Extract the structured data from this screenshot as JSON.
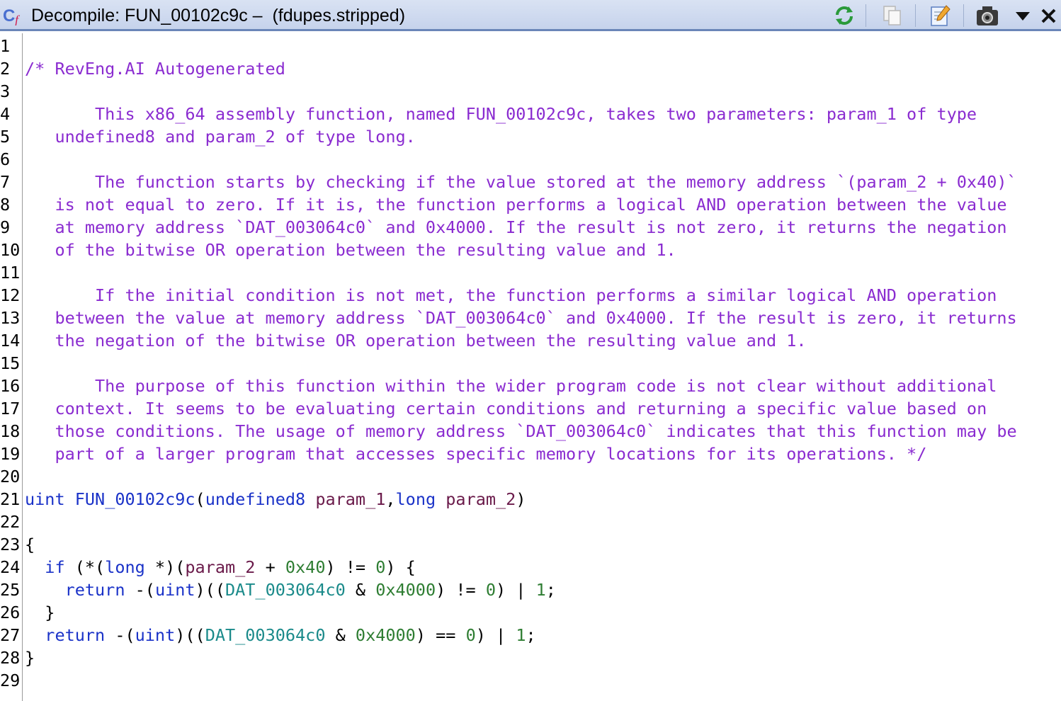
{
  "window": {
    "title": "Decompile: FUN_00102c9c –  (fdupes.stripped)",
    "toolbar": {
      "icons": [
        "refresh-icon",
        "copy-icon",
        "edit-icon",
        "snapshot-icon",
        "menu-dropdown-icon",
        "close-icon"
      ]
    }
  },
  "colors": {
    "comment": "#8a2bd0",
    "keyword": "#1a32c8",
    "parameter": "#6a1a4a",
    "number": "#2e7d32",
    "global_data": "#1a8a8a",
    "title_bar": "#c6d3ec"
  },
  "code": {
    "lines": [
      {
        "n": "1",
        "tokens": []
      },
      {
        "n": "2",
        "tokens": [
          {
            "t": "/* RevEng.AI Autogenerated",
            "c": "cmt"
          }
        ]
      },
      {
        "n": "3",
        "tokens": []
      },
      {
        "n": "4",
        "tokens": [
          {
            "t": "       This x86_64 assembly function, named FUN_00102c9c, takes two parameters: param_1 of type",
            "c": "cmt"
          }
        ]
      },
      {
        "n": "5",
        "tokens": [
          {
            "t": "   undefined8 and param_2 of type long.",
            "c": "cmt"
          }
        ]
      },
      {
        "n": "6",
        "tokens": []
      },
      {
        "n": "7",
        "tokens": [
          {
            "t": "       The function starts by checking if the value stored at the memory address `(param_2 + 0x40)`",
            "c": "cmt"
          }
        ]
      },
      {
        "n": "8",
        "tokens": [
          {
            "t": "   is not equal to zero. If it is, the function performs a logical AND operation between the value",
            "c": "cmt"
          }
        ]
      },
      {
        "n": "9",
        "tokens": [
          {
            "t": "   at memory address `DAT_003064c0` and 0x4000. If the result is not zero, it returns the negation",
            "c": "cmt"
          }
        ]
      },
      {
        "n": "10",
        "tokens": [
          {
            "t": "   of the bitwise OR operation between the resulting value and 1.",
            "c": "cmt"
          }
        ]
      },
      {
        "n": "11",
        "tokens": []
      },
      {
        "n": "12",
        "tokens": [
          {
            "t": "       If the initial condition is not met, the function performs a similar logical AND operation",
            "c": "cmt"
          }
        ]
      },
      {
        "n": "13",
        "tokens": [
          {
            "t": "   between the value at memory address `DAT_003064c0` and 0x4000. If the result is zero, it returns",
            "c": "cmt"
          }
        ]
      },
      {
        "n": "14",
        "tokens": [
          {
            "t": "   the negation of the bitwise OR operation between the resulting value and 1.",
            "c": "cmt"
          }
        ]
      },
      {
        "n": "15",
        "tokens": []
      },
      {
        "n": "16",
        "tokens": [
          {
            "t": "       The purpose of this function within the wider program code is not clear without additional",
            "c": "cmt"
          }
        ]
      },
      {
        "n": "17",
        "tokens": [
          {
            "t": "   context. It seems to be evaluating certain conditions and returning a specific value based on",
            "c": "cmt"
          }
        ]
      },
      {
        "n": "18",
        "tokens": [
          {
            "t": "   those conditions. The usage of memory address `DAT_003064c0` indicates that this function may be",
            "c": "cmt"
          }
        ]
      },
      {
        "n": "19",
        "tokens": [
          {
            "t": "   part of a larger program that accesses specific memory locations for its operations. */",
            "c": "cmt"
          }
        ]
      },
      {
        "n": "20",
        "tokens": []
      },
      {
        "n": "21",
        "tokens": [
          {
            "t": "uint",
            "c": "kw"
          },
          {
            "t": " ",
            "c": "pun"
          },
          {
            "t": "FUN_00102c9c",
            "c": "fn"
          },
          {
            "t": "(",
            "c": "pun"
          },
          {
            "t": "undefined8",
            "c": "kw"
          },
          {
            "t": " ",
            "c": "pun"
          },
          {
            "t": "param_1",
            "c": "prm"
          },
          {
            "t": ",",
            "c": "pun"
          },
          {
            "t": "long",
            "c": "kw"
          },
          {
            "t": " ",
            "c": "pun"
          },
          {
            "t": "param_2",
            "c": "prm"
          },
          {
            "t": ")",
            "c": "pun"
          }
        ]
      },
      {
        "n": "22",
        "tokens": []
      },
      {
        "n": "23",
        "tokens": [
          {
            "t": "{",
            "c": "pun"
          }
        ]
      },
      {
        "n": "24",
        "tokens": [
          {
            "t": "  ",
            "c": "pun"
          },
          {
            "t": "if",
            "c": "kw"
          },
          {
            "t": " (*(",
            "c": "pun"
          },
          {
            "t": "long",
            "c": "kw"
          },
          {
            "t": " *)(",
            "c": "pun"
          },
          {
            "t": "param_2",
            "c": "prm"
          },
          {
            "t": " + ",
            "c": "pun"
          },
          {
            "t": "0x40",
            "c": "num"
          },
          {
            "t": ") != ",
            "c": "pun"
          },
          {
            "t": "0",
            "c": "num"
          },
          {
            "t": ") {",
            "c": "pun"
          }
        ]
      },
      {
        "n": "25",
        "tokens": [
          {
            "t": "    ",
            "c": "pun"
          },
          {
            "t": "return",
            "c": "kw"
          },
          {
            "t": " -(",
            "c": "pun"
          },
          {
            "t": "uint",
            "c": "kw"
          },
          {
            "t": ")((",
            "c": "pun"
          },
          {
            "t": "DAT_003064c0",
            "c": "dat"
          },
          {
            "t": " & ",
            "c": "pun"
          },
          {
            "t": "0x4000",
            "c": "num"
          },
          {
            "t": ") != ",
            "c": "pun"
          },
          {
            "t": "0",
            "c": "num"
          },
          {
            "t": ") | ",
            "c": "pun"
          },
          {
            "t": "1",
            "c": "num"
          },
          {
            "t": ";",
            "c": "pun"
          }
        ]
      },
      {
        "n": "26",
        "tokens": [
          {
            "t": "  }",
            "c": "pun"
          }
        ]
      },
      {
        "n": "27",
        "tokens": [
          {
            "t": "  ",
            "c": "pun"
          },
          {
            "t": "return",
            "c": "kw"
          },
          {
            "t": " -(",
            "c": "pun"
          },
          {
            "t": "uint",
            "c": "kw"
          },
          {
            "t": ")((",
            "c": "pun"
          },
          {
            "t": "DAT_003064c0",
            "c": "dat"
          },
          {
            "t": " & ",
            "c": "pun"
          },
          {
            "t": "0x4000",
            "c": "num"
          },
          {
            "t": ") == ",
            "c": "pun"
          },
          {
            "t": "0",
            "c": "num"
          },
          {
            "t": ") | ",
            "c": "pun"
          },
          {
            "t": "1",
            "c": "num"
          },
          {
            "t": ";",
            "c": "pun"
          }
        ]
      },
      {
        "n": "28",
        "tokens": [
          {
            "t": "}",
            "c": "pun"
          }
        ]
      },
      {
        "n": "29",
        "tokens": []
      }
    ]
  }
}
